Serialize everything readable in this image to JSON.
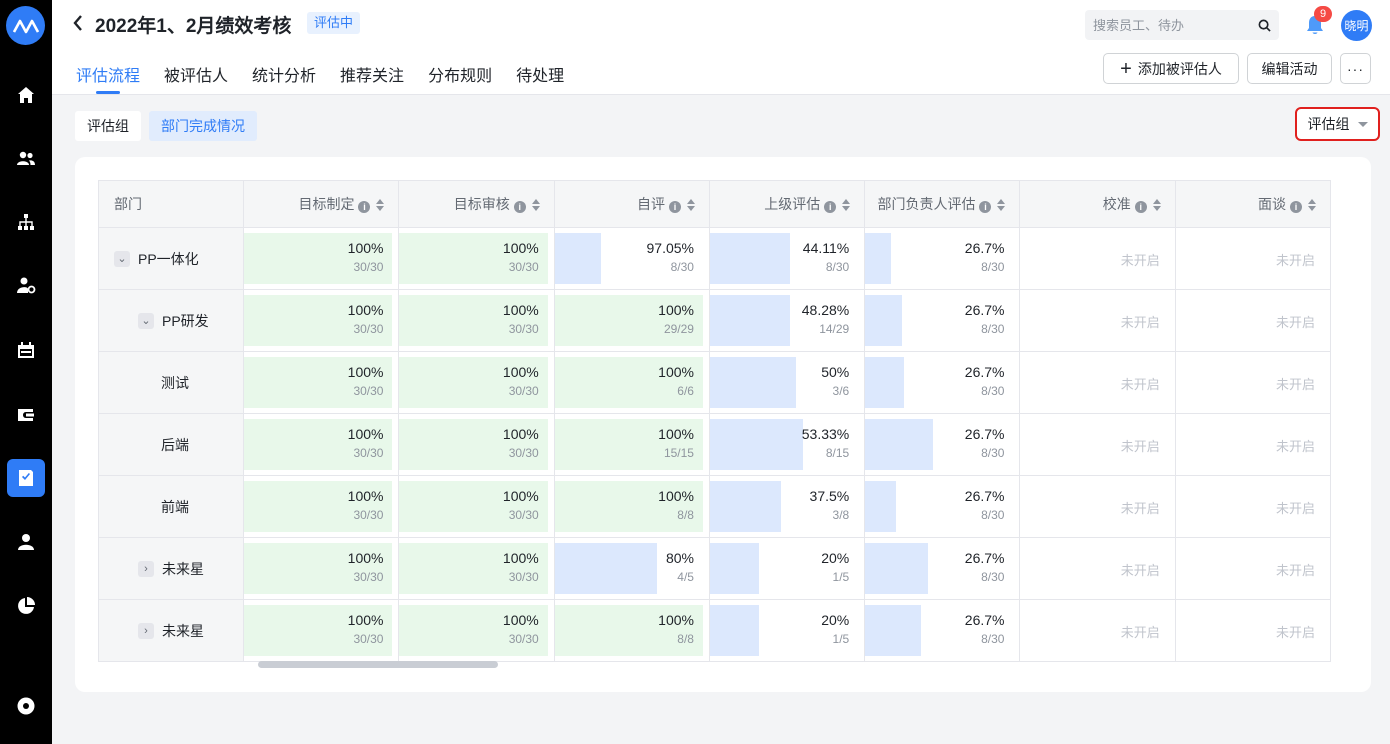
{
  "header": {
    "title": "2022年1、2月绩效考核",
    "status": "评估中",
    "search_placeholder": "搜索员工、待办",
    "notification_count": "9",
    "avatar_text": "晓明"
  },
  "tabs": [
    "评估流程",
    "被评估人",
    "统计分析",
    "推荐关注",
    "分布规则",
    "待处理"
  ],
  "actions": {
    "add_label": "添加被评估人",
    "edit_label": "编辑活动",
    "more_label": "···"
  },
  "subtabs": [
    "评估组",
    "部门完成情况"
  ],
  "group_select": "评估组",
  "table": {
    "columns": [
      "部门",
      "目标制定",
      "目标审核",
      "自评",
      "上级评估",
      "部门负责人评估",
      "校准",
      "面谈"
    ],
    "not_started": "未开启",
    "rows": [
      {
        "name": "PP一体化",
        "toggle": "⌄",
        "cells": [
          {
            "pct": "100%",
            "frac": "30/30",
            "p": 1.0
          },
          {
            "pct": "100%",
            "frac": "30/30",
            "p": 1.0
          },
          {
            "pct": "97.05%",
            "frac": "8/30",
            "p": 0.3
          },
          {
            "pct": "44.11%",
            "frac": "8/30",
            "p": 0.52
          },
          {
            "pct": "26.7%",
            "frac": "8/30",
            "p": 0.17
          }
        ]
      },
      {
        "name": "PP研发",
        "toggle": "⌄",
        "cells": [
          {
            "pct": "100%",
            "frac": "30/30",
            "p": 1.0
          },
          {
            "pct": "100%",
            "frac": "30/30",
            "p": 1.0
          },
          {
            "pct": "100%",
            "frac": "29/29",
            "p": 1.0
          },
          {
            "pct": "48.28%",
            "frac": "14/29",
            "p": 0.52
          },
          {
            "pct": "26.7%",
            "frac": "8/30",
            "p": 0.24
          }
        ]
      },
      {
        "name": "测试",
        "toggle": "",
        "cells": [
          {
            "pct": "100%",
            "frac": "30/30",
            "p": 1.0
          },
          {
            "pct": "100%",
            "frac": "30/30",
            "p": 1.0
          },
          {
            "pct": "100%",
            "frac": "6/6",
            "p": 1.0
          },
          {
            "pct": "50%",
            "frac": "3/6",
            "p": 0.56
          },
          {
            "pct": "26.7%",
            "frac": "8/30",
            "p": 0.25
          }
        ]
      },
      {
        "name": "后端",
        "toggle": "",
        "cells": [
          {
            "pct": "100%",
            "frac": "30/30",
            "p": 1.0
          },
          {
            "pct": "100%",
            "frac": "30/30",
            "p": 1.0
          },
          {
            "pct": "100%",
            "frac": "15/15",
            "p": 1.0
          },
          {
            "pct": "53.33%",
            "frac": "8/15",
            "p": 0.6
          },
          {
            "pct": "26.7%",
            "frac": "8/30",
            "p": 0.44
          }
        ]
      },
      {
        "name": "前端",
        "toggle": "",
        "cells": [
          {
            "pct": "100%",
            "frac": "30/30",
            "p": 1.0
          },
          {
            "pct": "100%",
            "frac": "30/30",
            "p": 1.0
          },
          {
            "pct": "100%",
            "frac": "8/8",
            "p": 1.0
          },
          {
            "pct": "37.5%",
            "frac": "3/8",
            "p": 0.46
          },
          {
            "pct": "26.7%",
            "frac": "8/30",
            "p": 0.2
          }
        ]
      },
      {
        "name": "未来星",
        "toggle": "›",
        "cells": [
          {
            "pct": "100%",
            "frac": "30/30",
            "p": 1.0
          },
          {
            "pct": "100%",
            "frac": "30/30",
            "p": 1.0
          },
          {
            "pct": "80%",
            "frac": "4/5",
            "p": 0.66
          },
          {
            "pct": "20%",
            "frac": "1/5",
            "p": 0.32
          },
          {
            "pct": "26.7%",
            "frac": "8/30",
            "p": 0.41
          }
        ]
      },
      {
        "name": "未来星",
        "toggle": "›",
        "cells": [
          {
            "pct": "100%",
            "frac": "30/30",
            "p": 1.0
          },
          {
            "pct": "100%",
            "frac": "30/30",
            "p": 1.0
          },
          {
            "pct": "100%",
            "frac": "8/8",
            "p": 1.0
          },
          {
            "pct": "20%",
            "frac": "1/5",
            "p": 0.32
          },
          {
            "pct": "26.7%",
            "frac": "8/30",
            "p": 0.36
          }
        ]
      }
    ]
  }
}
